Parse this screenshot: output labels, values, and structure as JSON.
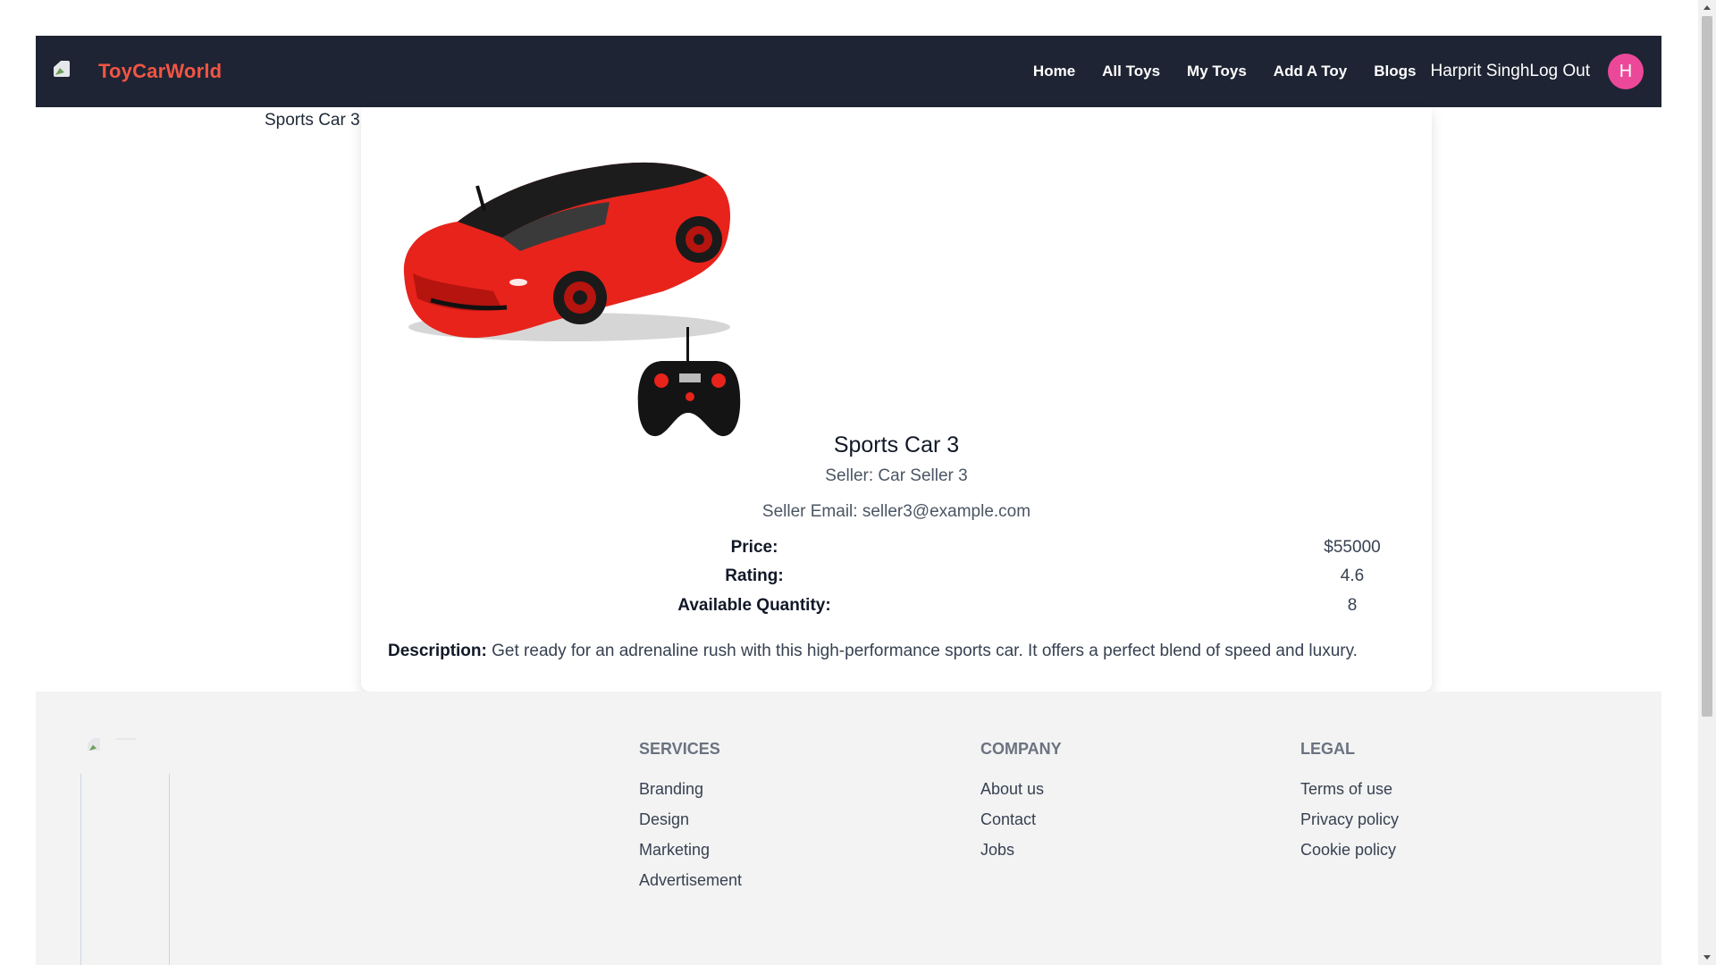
{
  "nav": {
    "brand": "ToyCarWorld",
    "links": [
      "Home",
      "All Toys",
      "My Toys",
      "Add A Toy",
      "Blogs"
    ],
    "user_name": "Harprit Singh",
    "logout_label": "Log Out",
    "avatar_initial": "H"
  },
  "breadcrumb": "Sports Car 3",
  "product": {
    "title": "Sports Car 3",
    "seller": "Seller: Car Seller 3",
    "email": "Seller Email: seller3@example.com",
    "price_label": "Price:",
    "price": "$55000",
    "rating_label": "Rating:",
    "rating": "4.6",
    "quantity_label": "Available Quantity:",
    "quantity": "8",
    "description_label": "Description:",
    "description": "Get ready for an adrenaline rush with this high-performance sports car. It offers a perfect blend of speed and luxury."
  },
  "footer": {
    "services": {
      "heading": "SERVICES",
      "links": [
        "Branding",
        "Design",
        "Marketing",
        "Advertisement"
      ]
    },
    "company": {
      "heading": "COMPANY",
      "links": [
        "About us",
        "Contact",
        "Jobs"
      ]
    },
    "legal": {
      "heading": "LEGAL",
      "links": [
        "Terms of use",
        "Privacy policy",
        "Cookie policy"
      ]
    }
  },
  "colors": {
    "nav_bg": "#1e2433",
    "brand": "#f25544",
    "avatar": "#ec4899",
    "car_red": "#e8231b",
    "footer_bg": "#f3f3f3"
  }
}
